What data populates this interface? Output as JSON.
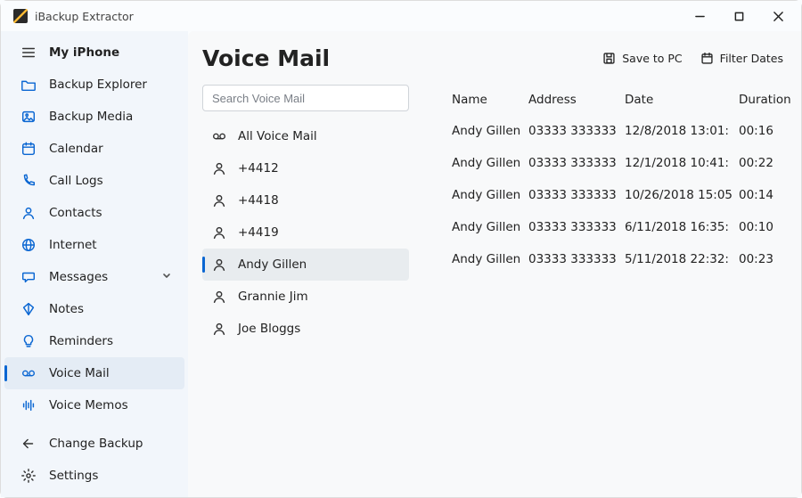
{
  "app": {
    "title": "iBackup Extractor"
  },
  "sidebar": {
    "header": "My iPhone",
    "items": [
      {
        "label": "Backup Explorer"
      },
      {
        "label": "Backup Media"
      },
      {
        "label": "Calendar"
      },
      {
        "label": "Call Logs"
      },
      {
        "label": "Contacts"
      },
      {
        "label": "Internet"
      },
      {
        "label": "Messages",
        "expandable": true
      },
      {
        "label": "Notes"
      },
      {
        "label": "Reminders"
      },
      {
        "label": "Voice Mail",
        "active": true
      },
      {
        "label": "Voice Memos"
      }
    ],
    "bottom": [
      {
        "label": "Change Backup"
      },
      {
        "label": "Settings"
      }
    ]
  },
  "main": {
    "title": "Voice Mail",
    "actions": {
      "save": "Save to PC",
      "filter": "Filter Dates"
    },
    "search_placeholder": "Search Voice Mail",
    "filters": [
      {
        "label": "All Voice Mail",
        "icon": "voicemail"
      },
      {
        "label": "+4412",
        "icon": "person"
      },
      {
        "label": "+4418",
        "icon": "person"
      },
      {
        "label": "+4419",
        "icon": "person"
      },
      {
        "label": "Andy Gillen",
        "icon": "person",
        "active": true
      },
      {
        "label": "Grannie Jim",
        "icon": "person"
      },
      {
        "label": "Joe Bloggs",
        "icon": "person"
      }
    ],
    "columns": [
      "Name",
      "Address",
      "Date",
      "Duration"
    ],
    "rows": [
      {
        "name": "Andy Gillen",
        "address": "03333 333333",
        "date": "12/8/2018 13:01:",
        "duration": "00:16"
      },
      {
        "name": "Andy Gillen",
        "address": "03333 333333",
        "date": "12/1/2018 10:41:",
        "duration": "00:22"
      },
      {
        "name": "Andy Gillen",
        "address": "03333 333333",
        "date": "10/26/2018 15:05",
        "duration": "00:14"
      },
      {
        "name": "Andy Gillen",
        "address": "03333 333333",
        "date": "6/11/2018 16:35:",
        "duration": "00:10"
      },
      {
        "name": "Andy Gillen",
        "address": "03333 333333",
        "date": "5/11/2018 22:32:",
        "duration": "00:23"
      }
    ]
  }
}
